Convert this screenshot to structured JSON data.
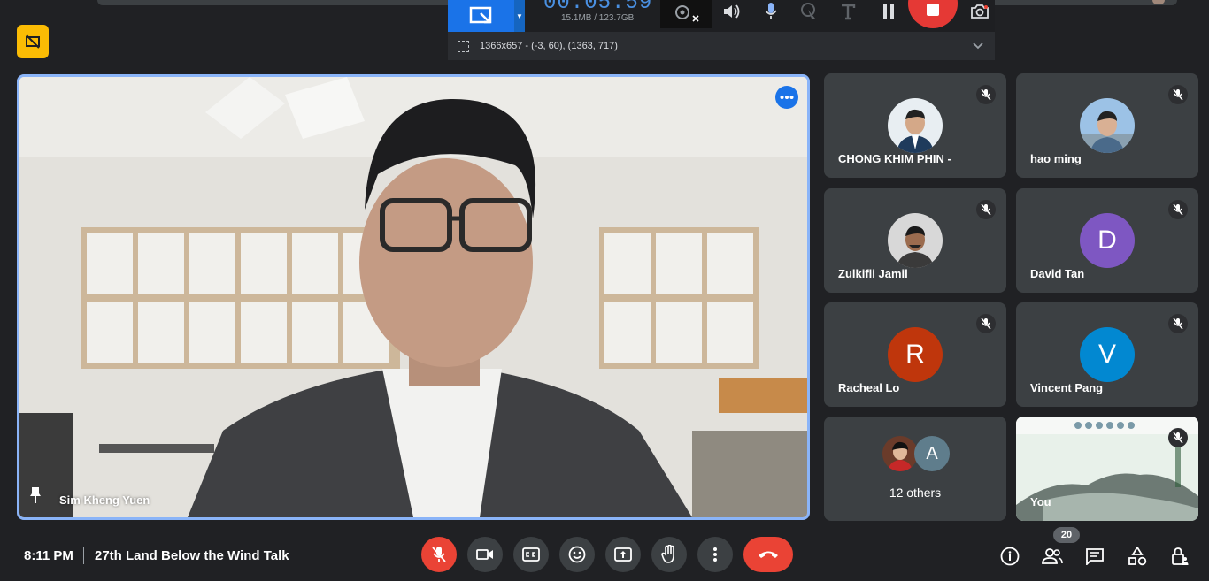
{
  "recorder": {
    "timer": "00:05:59",
    "size_info": "15.1MB / 123.7GB",
    "region_dims": "1366x657 - (-3, 60), (1363, 717)",
    "icons": [
      "region-select-icon",
      "webcam-icon",
      "speaker-icon",
      "microphone-icon",
      "cursor-highlight-icon",
      "text-icon",
      "pause-icon",
      "stop-icon",
      "screenshot-icon"
    ]
  },
  "main": {
    "presenter_name": "Sim Kheng Yuen",
    "accent": "#8ab4f8"
  },
  "participants": [
    {
      "name": "CHONG KHIM PHIN -",
      "avatar_type": "photo"
    },
    {
      "name": "hao ming",
      "avatar_type": "photo"
    },
    {
      "name": "Zulkifli Jamil",
      "avatar_type": "photo"
    },
    {
      "name": "David Tan",
      "initial": "D",
      "color": "#7e57c2"
    },
    {
      "name": "Racheal Lo",
      "initial": "R",
      "color": "#bf360c"
    },
    {
      "name": "Vincent Pang",
      "initial": "V",
      "color": "#0288d1"
    }
  ],
  "others": {
    "label": "12 others",
    "initial": "A",
    "initial_color": "#5f7d8c"
  },
  "self_tile": {
    "name": "You"
  },
  "bottom_bar": {
    "time": "8:11 PM",
    "meeting_title": "27th Land Below the Wind Talk",
    "participant_count": "20",
    "end_call_color": "#ea4335"
  }
}
